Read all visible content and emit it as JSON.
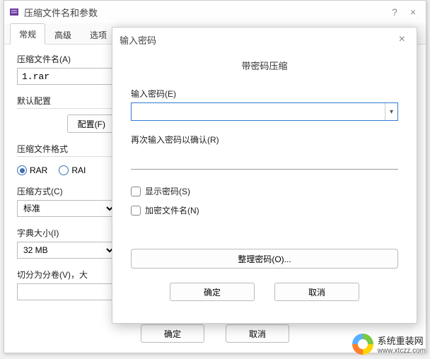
{
  "main": {
    "title": "压缩文件名和参数",
    "help": "?",
    "close": "×",
    "tabs": {
      "general": "常规",
      "advanced": "高级",
      "options": "选项"
    },
    "archive_label": "压缩文件名(A)",
    "archive_value": "1.rar",
    "profile_label": "默认配置",
    "profile_button": "配置(F)",
    "format_label": "压缩文件格式",
    "format_rar": "RAR",
    "format_rar5": "RAI",
    "method_label": "压缩方式(C)",
    "method_value": "标准",
    "dict_label": "字典大小(I)",
    "dict_value": "32 MB",
    "vol_label": "切分为分卷(V)，大",
    "ok": "确定",
    "cancel": "取消"
  },
  "pwd": {
    "title": "输入密码",
    "close": "×",
    "heading": "带密码压缩",
    "enter_label": "输入密码(E)",
    "confirm_label": "再次输入密码以确认(R)",
    "show": "显示密码(S)",
    "encrypt_names": "加密文件名(N)",
    "organize": "整理密码(O)...",
    "ok": "确定",
    "cancel": "取消"
  },
  "watermark": {
    "name": "系统重装网",
    "url": "www.xtczz.com"
  }
}
